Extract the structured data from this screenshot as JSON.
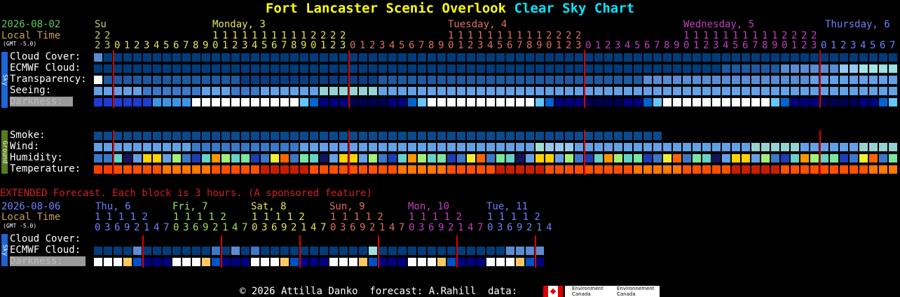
{
  "title": {
    "site": "Fort Lancaster Scenic Overlook",
    "suffix": "Clear Sky Chart"
  },
  "header": {
    "date": "2026-08-02",
    "local_time": "Local Time",
    "gmt": "(GMT -5.0)",
    "days": [
      {
        "label": "Su",
        "color": "#c8c864"
      },
      {
        "label": "Monday, 3",
        "color": "#e6e65a"
      },
      {
        "label": "Tuesday, 4",
        "color": "#e07060"
      },
      {
        "label": "Wednesday, 5",
        "color": "#c040c0"
      },
      {
        "label": "Thursday, 6",
        "color": "#7080ff"
      }
    ],
    "hour_tens": "2 2                 1 1 1 1 1 1 1 1 1 1 2 2 2 2                     1 1 1 1 1 1 1 1 1 1 2 2 2 2                     1 1 1 1 1 1 1 1 1 1 2 2 2 2",
    "hour_ones": "2 3 0 1 2 3 4 5 6 7 8 9 0 1 2 3 4 5 6 7 8 9 0 1 2 3 0 1 2 3 4 5 6 7 8 9 0 1 2 3 4 5 6 7 8 9 0 1 2 3 0 1 2 3 4 5 6 7 8 9 0 1 2 3 4 5 6 7 8 9 0 1 2 3 0 1 2 3 4 5 6 7"
  },
  "rows": {
    "cloud": "Cloud Cover:",
    "ecmwf": "ECMWF Cloud:",
    "transparency": "Transparency:",
    "seeing": "Seeing:",
    "darkness": "Darkness:",
    "smoke": "Smoke:",
    "wind": "Wind:",
    "humidity": "Humidity:",
    "temperature": "Temperature:"
  },
  "side_labels": {
    "sky": "Sky",
    "ground": "Ground"
  },
  "extended": {
    "note": "EXTENDED Forecast. Each block is 3 hours. (A sponsored feature)",
    "date": "2026-08-06",
    "local_time": "Local Time",
    "gmt": "(GMT -5.0)",
    "days": [
      {
        "label": "Thu, 6",
        "color": "#7080ff"
      },
      {
        "label": "Fri, 7",
        "color": "#a0e060"
      },
      {
        "label": "Sat, 8",
        "color": "#e6e65a"
      },
      {
        "label": "Sun, 9",
        "color": "#e07060"
      },
      {
        "label": "Mon, 10",
        "color": "#c040c0"
      },
      {
        "label": "Tue, 11",
        "color": "#7080ff"
      }
    ],
    "hour_tens": "1 1 1 1 2",
    "hour_ones": "0 3 6 9 2 1 4 7",
    "rows": {
      "cloud": "Cloud Cover:",
      "ecmwf": "ECMWF Cloud:",
      "darkness": "Darkness:"
    }
  },
  "footer": {
    "text": "© 2026 Attilla Danko  forecast: A.Rahill  data:",
    "env1": "Environment\nCanada",
    "env2": "Environnement\nCanada"
  },
  "colors": {
    "cloud_dark": "#003c7a",
    "cloud_mid": "#1e5aa0",
    "cloud_light": "#5a8cd2",
    "seeing_light": "#64a0e6",
    "red_line": "#d00000"
  }
}
